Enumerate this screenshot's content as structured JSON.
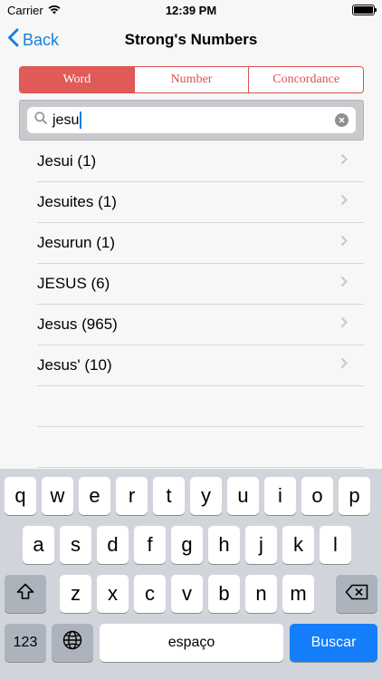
{
  "status_bar": {
    "carrier": "Carrier",
    "time": "12:39 PM"
  },
  "nav": {
    "back_label": "Back",
    "title": "Strong's Numbers"
  },
  "segments": [
    {
      "label": "Word",
      "selected": true
    },
    {
      "label": "Number",
      "selected": false
    },
    {
      "label": "Concordance",
      "selected": false
    }
  ],
  "search": {
    "value": "jesu"
  },
  "results": [
    {
      "label": "Jesui (1)"
    },
    {
      "label": "Jesuites (1)"
    },
    {
      "label": "Jesurun (1)"
    },
    {
      "label": "JESUS (6)"
    },
    {
      "label": "Jesus (965)"
    },
    {
      "label": "Jesus' (10)"
    }
  ],
  "keyboard": {
    "row1": [
      "q",
      "w",
      "e",
      "r",
      "t",
      "y",
      "u",
      "i",
      "o",
      "p"
    ],
    "row2": [
      "a",
      "s",
      "d",
      "f",
      "g",
      "h",
      "j",
      "k",
      "l"
    ],
    "row3": [
      "z",
      "x",
      "c",
      "v",
      "b",
      "n",
      "m"
    ],
    "numbers_label": "123",
    "space_label": "espaço",
    "return_label": "Buscar"
  },
  "colors": {
    "accent_red": "#e05a57",
    "link_blue": "#1a7ee0",
    "return_blue": "#147efb"
  }
}
